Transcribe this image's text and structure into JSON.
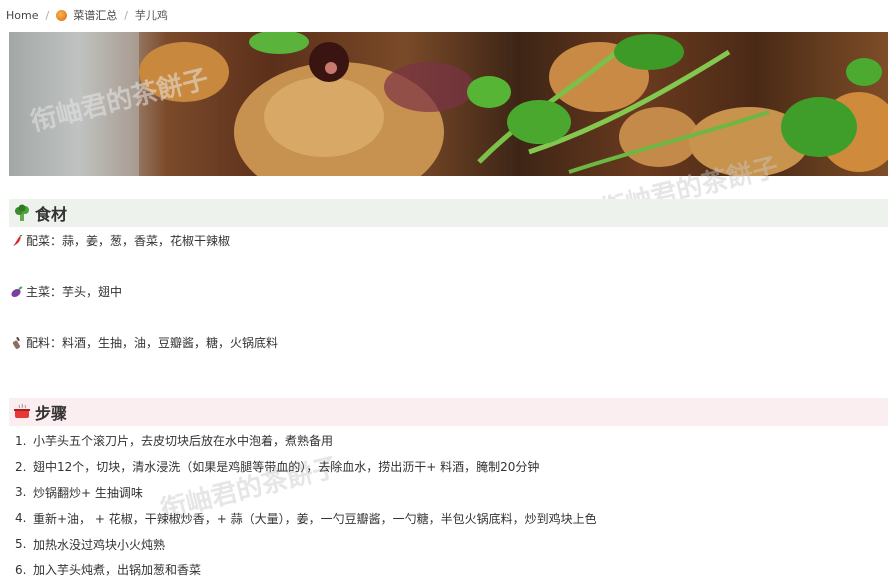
{
  "breadcrumb": {
    "home": "Home",
    "category": "菜谱汇总",
    "current": "芋儿鸡"
  },
  "watermark_text": "衔岫君的茶餅子",
  "ingredients": {
    "title": "食材",
    "lines": [
      {
        "icon": "chili-icon",
        "text": "配菜：蒜，姜，葱，香菜，花椒干辣椒"
      },
      {
        "icon": "eggplant-icon",
        "text": "主菜：芋头，翅中"
      },
      {
        "icon": "bottle-icon",
        "text": "配料：料酒，生抽，油，豆瓣酱，糖，火锅底料"
      }
    ]
  },
  "steps": {
    "title": "步骤",
    "items": [
      {
        "num": "1.",
        "text": "小芋头五个滚刀片，去皮切块后放在水中泡着，煮熟备用"
      },
      {
        "num": "2.",
        "text": " 翅中12个，切块，清水浸洗（如果是鸡腿等带血的），去除血水，捞出沥干+ 料酒，腌制20分钟"
      },
      {
        "num": "3.",
        "text": "炒锅翻炒+ 生抽调味"
      },
      {
        "num": "4.",
        "text": "重新+油， + 花椒，干辣椒炒香，+ 蒜（大量），姜，一勺豆瓣酱，一勺糖，半包火锅底料，炒到鸡块上色"
      },
      {
        "num": "5.",
        "text": "加热水没过鸡块小火炖熟"
      },
      {
        "num": "6.",
        "text": "加入芋头炖煮，出锅加葱和香菜"
      }
    ]
  }
}
